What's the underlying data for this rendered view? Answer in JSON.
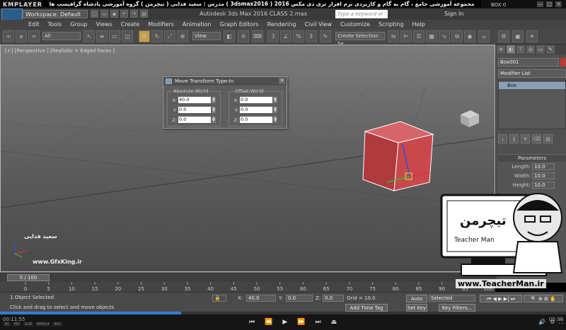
{
  "player": {
    "brand": "KMPLAYER",
    "persian_title": "مجموعه آموزشی جامع ، گام به گام و کاربردی نرم افزار تری دی مکس 2016 ( 3dsmax2016 ) مدرس : سعید فدایی ( تیچرمن ) گروه آموزشی پادشاه گرافیست ها",
    "box_tag": "BOX 0",
    "window_controls": [
      "—",
      "□",
      "✕"
    ],
    "time_elapsed": "00:11:55",
    "time_total": "00:38",
    "progress_fraction": 0.32,
    "left_tags": [
      "3D",
      "MX",
      "GLB",
      "MPEG4",
      "AVC"
    ],
    "controls": [
      "⏮",
      "⏪",
      "▶",
      "⏩",
      "⏭",
      "⏏"
    ]
  },
  "app": {
    "logo": "MAX",
    "workspace": "Workspace: Default",
    "title": "Autodesk 3ds Max 2016     CLASS 2.max",
    "search_placeholder": "Type a keyword or phrase",
    "sign_in": "Sign In"
  },
  "menu": [
    "Edit",
    "Tools",
    "Group",
    "Views",
    "Create",
    "Modifiers",
    "Animation",
    "Graph Editors",
    "Rendering",
    "Civil View",
    "Customize",
    "Scripting",
    "Help"
  ],
  "toolbar": {
    "filter": "All",
    "ref_coord": "View",
    "selection_set": "Create Selection Se"
  },
  "viewport": {
    "label": "[+] [Perspective ] [Realistic + Edged Faces ]"
  },
  "dialog": {
    "title": "Move Transform Type-In",
    "absolute_title": "Absolute:World",
    "offset_title": "Offset:World",
    "absolute": [
      {
        "axis": "X:",
        "value": "40.0"
      },
      {
        "axis": "Y:",
        "value": "0.0"
      },
      {
        "axis": "Z:",
        "value": "0.0"
      }
    ],
    "offset": [
      {
        "axis": "X:",
        "value": "0.0"
      },
      {
        "axis": "Y:",
        "value": "0.0"
      },
      {
        "axis": "Z:",
        "value": "0.0"
      }
    ]
  },
  "command_panel": {
    "object_name": "Box001",
    "modifier_list": "Modifier List",
    "stack_item": "Box",
    "params_title": "Parameters",
    "params": [
      {
        "label": "Length:",
        "value": "10.0"
      },
      {
        "label": "Width:",
        "value": "10.0"
      },
      {
        "label": "Height:",
        "value": "10.0"
      }
    ]
  },
  "timeline": {
    "thumb": "0 / 100",
    "ticks": [
      "0",
      "5",
      "10",
      "15",
      "20",
      "25",
      "30",
      "35",
      "40",
      "45",
      "50",
      "55",
      "60",
      "65",
      "70",
      "75",
      "80",
      "85",
      "90",
      "95",
      "100"
    ]
  },
  "status": {
    "selected": "1 Object Selected",
    "prompt": "Click and drag to select and move objects",
    "x": "40.0",
    "y": "0.0",
    "z": "0.0",
    "grid": "Grid = 10.0",
    "add_time_tag": "Add Time Tag",
    "auto_key": "Auto Key",
    "set_key": "Set Key",
    "selected_dd": "Selected",
    "key_filters": "Key Filters..."
  },
  "watermark": {
    "author": "سعید فدایی",
    "site": "www.GfxKing.ir",
    "teacher": "Teacher Man",
    "teacher_fa": "تیچرمن",
    "teacher_url": "www.TeacherMan.ir"
  }
}
